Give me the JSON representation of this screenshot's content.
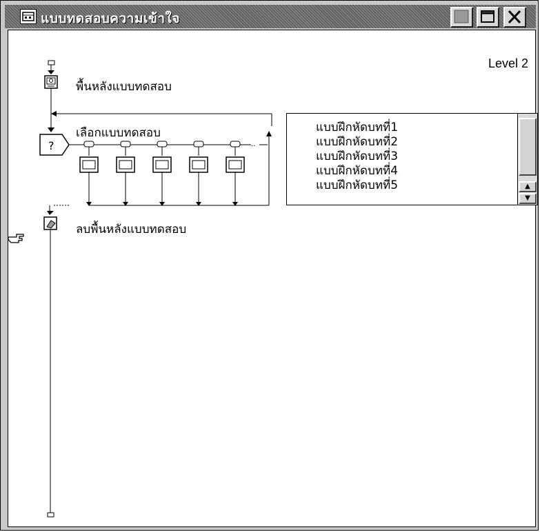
{
  "window": {
    "title": "แบบทดสอบความเข้าใจ",
    "level": "Level 2"
  },
  "flowline": {
    "background_icon_label": "พื้นหลังแบบทดสอบ",
    "decision_label": "เลือกแบบทดสอบ",
    "decision_symbol": "?",
    "erase_icon_label": "ลบพื้นหลังแบบทดสอบ"
  },
  "list": {
    "items": [
      "แบบฝึกหัดบทที่1",
      "แบบฝึกหัดบทที่2",
      "แบบฝึกหัดบทที่3",
      "แบบฝึกหัดบทที่4",
      "แบบฝึกหัดบทที่5"
    ]
  },
  "icons": {
    "title": "map-icon",
    "minimize": "minimize-icon",
    "maximize": "maximize-icon",
    "close": "close-icon",
    "pointer": "hand-pointer-icon"
  }
}
